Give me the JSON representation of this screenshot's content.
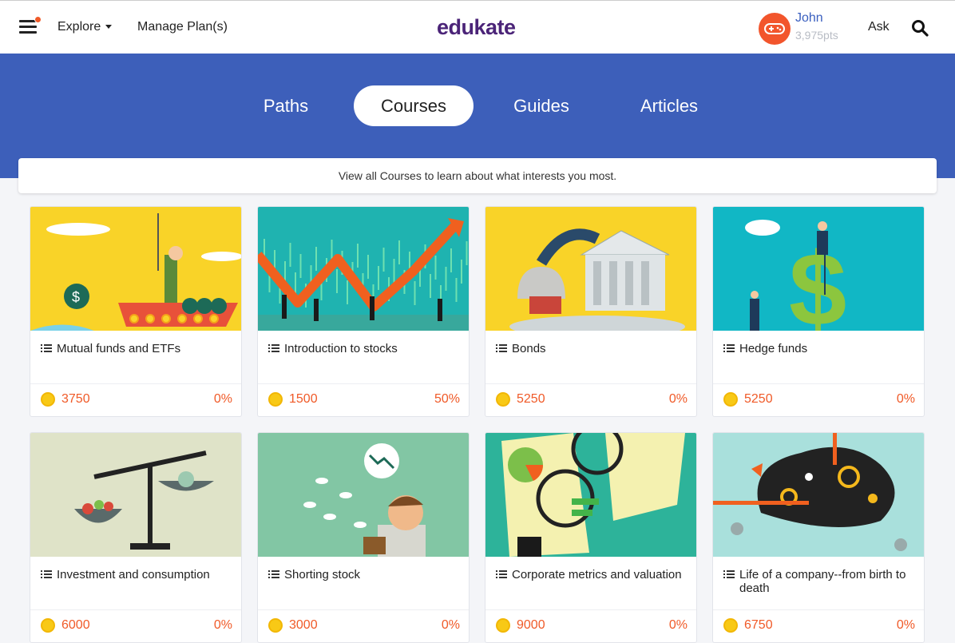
{
  "header": {
    "explore_label": "Explore",
    "manage_label": "Manage Plan(s)",
    "logo": "edukate",
    "user_name": "John",
    "user_points": "3,975pts",
    "ask_label": "Ask"
  },
  "tabs": [
    {
      "label": "Paths",
      "active": false
    },
    {
      "label": "Courses",
      "active": true
    },
    {
      "label": "Guides",
      "active": false
    },
    {
      "label": "Articles",
      "active": false
    }
  ],
  "notice": "View all Courses to learn about what interests you most.",
  "courses": [
    {
      "title": "Mutual funds and ETFs",
      "points": "3750",
      "progress": "0%",
      "image": "fishing-money-illustration"
    },
    {
      "title": "Introduction to stocks",
      "points": "1500",
      "progress": "50%",
      "image": "stock-chart-illustration"
    },
    {
      "title": "Bonds",
      "points": "5250",
      "progress": "0%",
      "image": "bank-building-illustration"
    },
    {
      "title": "Hedge funds",
      "points": "5250",
      "progress": "0%",
      "image": "dollar-sign-illustration"
    },
    {
      "title": "Investment and consumption",
      "points": "6000",
      "progress": "0%",
      "image": "balance-scale-illustration"
    },
    {
      "title": "Shorting stock",
      "points": "3000",
      "progress": "0%",
      "image": "worried-man-illustration"
    },
    {
      "title": "Corporate metrics and valuation",
      "points": "9000",
      "progress": "0%",
      "image": "magnifier-documents-illustration"
    },
    {
      "title": "Life of a company--from birth to death",
      "points": "6750",
      "progress": "0%",
      "image": "brain-gears-illustration"
    }
  ],
  "colors": {
    "brand": "#4b2478",
    "hero": "#3d5fba",
    "accent": "#f05a28",
    "coin": "#f8c916"
  }
}
